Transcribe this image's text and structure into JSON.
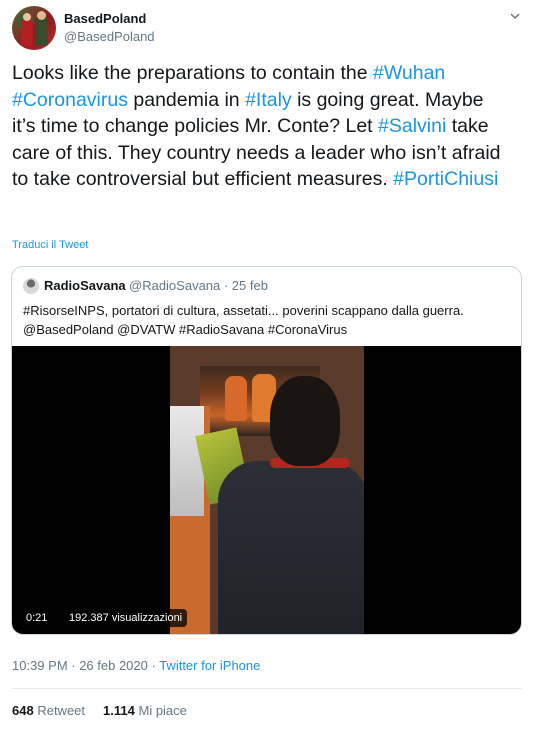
{
  "author": {
    "display_name": "BasedPoland",
    "handle": "@BasedPoland"
  },
  "tweet": {
    "segments": [
      {
        "text": "Looks like the preparations to contain the ",
        "type": "text"
      },
      {
        "text": "#Wuhan",
        "type": "hashtag"
      },
      {
        "text": " ",
        "type": "text"
      },
      {
        "text": "#Coronavirus",
        "type": "hashtag"
      },
      {
        "text": " pandemia in ",
        "type": "text"
      },
      {
        "text": "#Italy",
        "type": "hashtag"
      },
      {
        "text": " is going great. Maybe it’s time to change policies Mr. Conte? Let ",
        "type": "text"
      },
      {
        "text": "#Salvini",
        "type": "hashtag"
      },
      {
        "text": " take care of this. They country needs a leader who isn’t afraid to take controversial but efficient measures. ",
        "type": "text"
      },
      {
        "text": "#PortiChiusi",
        "type": "hashtag"
      }
    ],
    "translate_label": "Traduci il Tweet"
  },
  "quoted_tweet": {
    "display_name": "RadioSavana",
    "handle_and_date": "@RadioSavana · 25 feb",
    "text_line1": "#RisorseINPS, portatori di cultura, assetati... poverini scappano dalla guerra.",
    "text_line2": "@BasedPoland @DVATW #RadioSavana #CoronaVirus",
    "video": {
      "duration": "0:21",
      "views": "192.387 visualizzazioni"
    }
  },
  "meta": {
    "timestamp": "10:39 PM · 26 feb 2020 · ",
    "source": "Twitter for iPhone"
  },
  "stats": {
    "retweets_count": "648",
    "retweets_label": "Retweet",
    "likes_count": "1.114",
    "likes_label": "Mi piace"
  },
  "colors": {
    "accent": "#1b95e0",
    "text": "#14171a",
    "muted": "#657786",
    "border": "#ccd6dd"
  },
  "icons": {
    "menu": "chevron-down-icon"
  }
}
